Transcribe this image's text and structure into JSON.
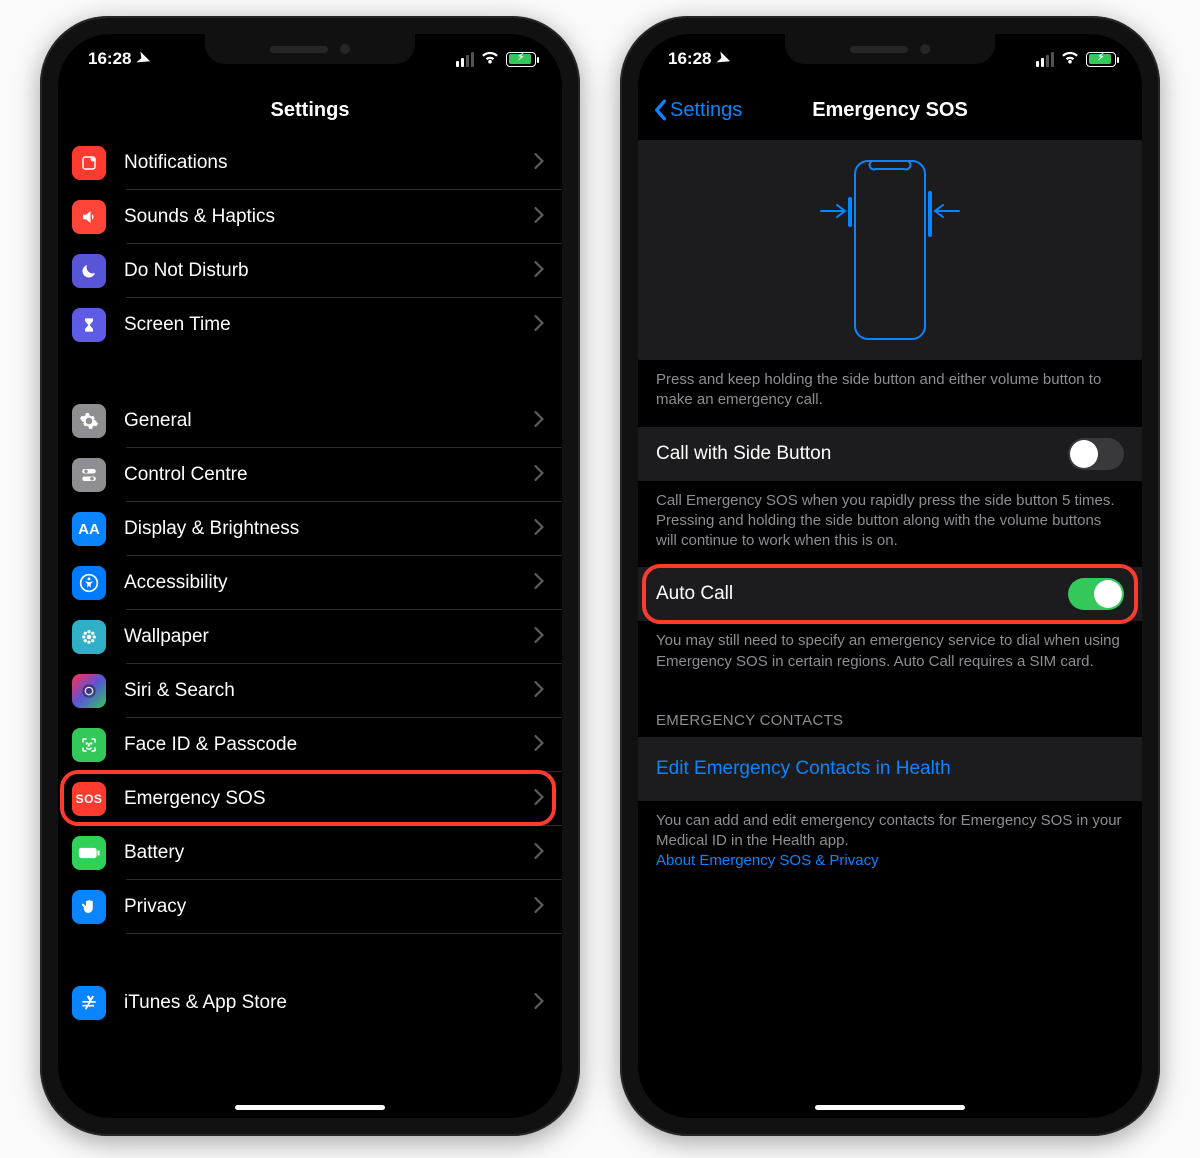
{
  "status": {
    "time": "16:28"
  },
  "left": {
    "title": "Settings",
    "items1": [
      {
        "label": "Notifications"
      },
      {
        "label": "Sounds & Haptics"
      },
      {
        "label": "Do Not Disturb"
      },
      {
        "label": "Screen Time"
      }
    ],
    "items2": [
      {
        "label": "General"
      },
      {
        "label": "Control Centre"
      },
      {
        "label": "Display & Brightness"
      },
      {
        "label": "Accessibility"
      },
      {
        "label": "Wallpaper"
      },
      {
        "label": "Siri & Search"
      },
      {
        "label": "Face ID & Passcode"
      },
      {
        "label": "Emergency SOS"
      },
      {
        "label": "Battery"
      },
      {
        "label": "Privacy"
      }
    ],
    "items3": [
      {
        "label": "iTunes & App Store"
      }
    ]
  },
  "right": {
    "back": "Settings",
    "title": "Emergency SOS",
    "hero_footer": "Press and keep holding the side button and either volume button to make an emergency call.",
    "call_side": {
      "label": "Call with Side Button",
      "footer": "Call Emergency SOS when you rapidly press the side button 5 times. Pressing and holding the side button along with the volume buttons will continue to work when this is on."
    },
    "auto_call": {
      "label": "Auto Call",
      "footer": "You may still need to specify an emergency service to dial when using Emergency SOS in certain regions. Auto Call requires a SIM card."
    },
    "contacts_header": "EMERGENCY CONTACTS",
    "edit_link": "Edit Emergency Contacts in Health",
    "contacts_footer": "You can add and edit emergency contacts for Emergency SOS in your Medical ID in the Health app.",
    "privacy_link": "About Emergency SOS & Privacy"
  },
  "icons": {
    "sos": "SOS",
    "aa": "AA"
  }
}
